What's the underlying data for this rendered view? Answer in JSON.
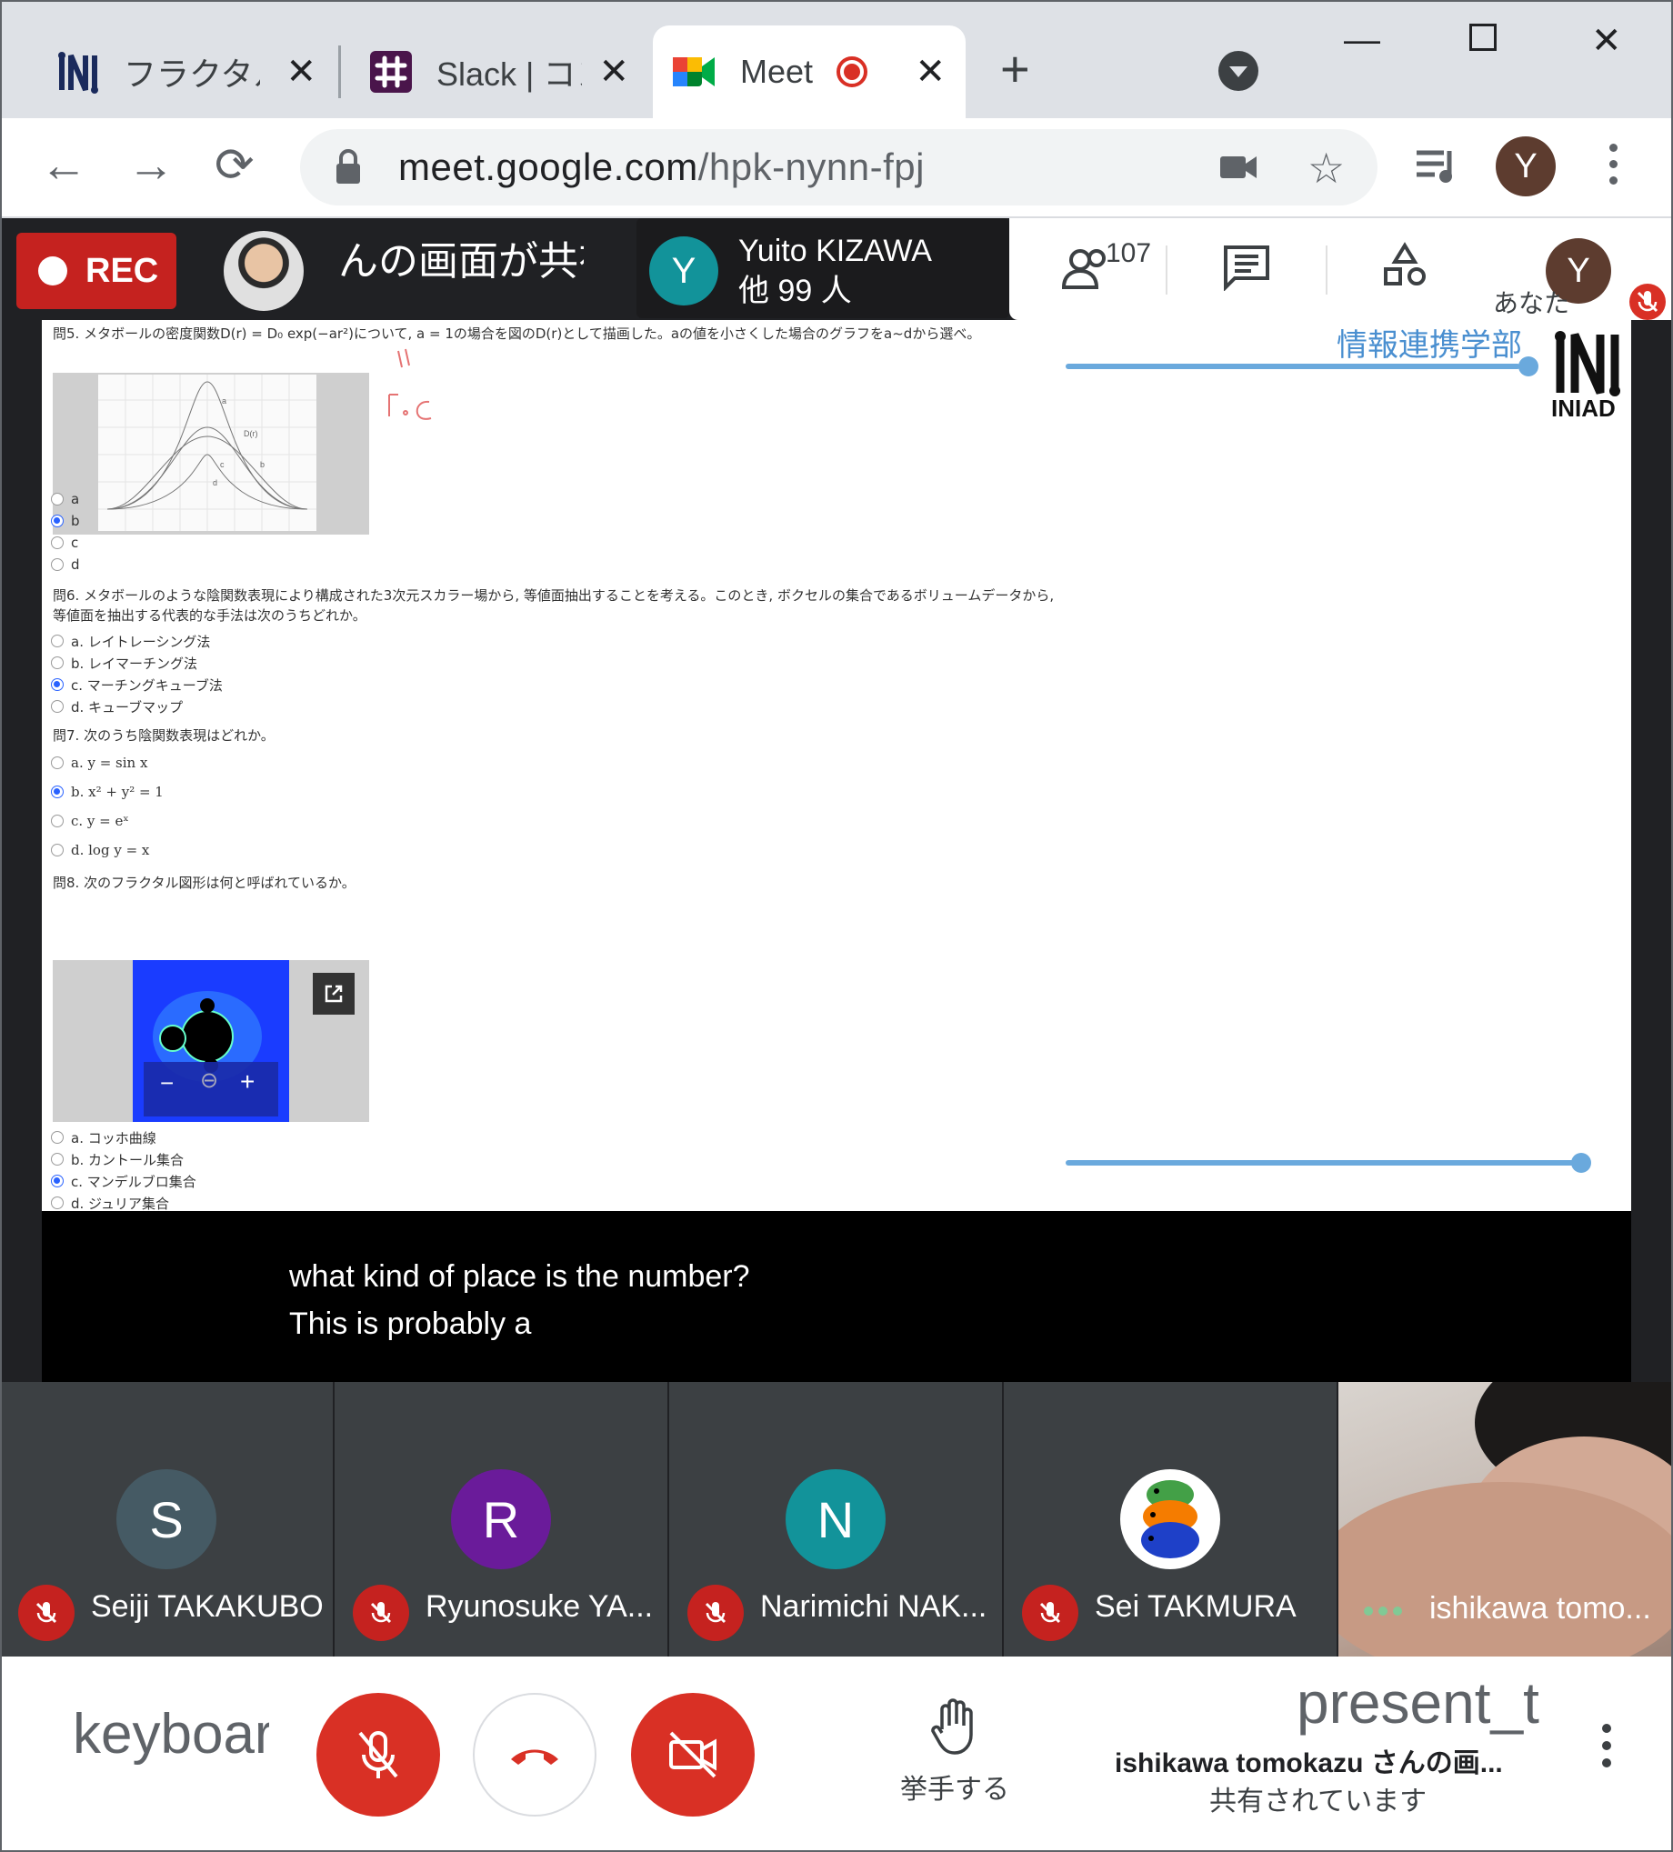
{
  "browser": {
    "tabs": [
      {
        "title": "フラクタルの",
        "icon": "iniad-favicon"
      },
      {
        "title": "Slack | コン",
        "icon": "slack-favicon"
      },
      {
        "title": "Meet",
        "icon": "meet-favicon",
        "recording": true
      }
    ],
    "url_host": "meet.google.com",
    "url_path": "/hpk-nynn-fpj",
    "profile_initial": "Y"
  },
  "meeting": {
    "rec_label": "REC",
    "presenter_text": "んの画面が共有されています",
    "pinned": {
      "initial": "Y",
      "name": "Yuito KIZAWA",
      "others": "他 99 人"
    },
    "participant_count": "107",
    "self_initial": "Y",
    "self_label": "あなた"
  },
  "slide": {
    "brand": "情報連携学部",
    "logo_text": "INIAD",
    "q5_text": "問5. メタボールの密度関数D(r) = D₀ exp(−ar²)について, a = 1の場合を図のD(r)として描画した。aの値を小さくした場合のグラフをa~dから選べ。",
    "q5_options": [
      "a",
      "b",
      "c",
      "d"
    ],
    "q5_selected": 1,
    "graph_labels": {
      "a": "a",
      "b": "b",
      "c": "c",
      "d": "d",
      "curve": "D(r)"
    },
    "q6_text": "問6. メタボールのような陰関数表現により構成された3次元スカラー場から, 等値面抽出することを考える。このとき, ボクセルの集合であるボリュームデータから, 等値面を抽出する代表的な手法は次のうちどれか。",
    "q6_options": [
      "a. レイトレーシング法",
      "b. レイマーチング法",
      "c. マーチングキューブ法",
      "d. キューブマップ"
    ],
    "q6_selected": 2,
    "q7_text": "問7. 次のうち陰関数表現はどれか。",
    "q7_options": [
      "a. y = sin x",
      "b. x² + y² = 1",
      "c. y = eˣ",
      "d. log y = x"
    ],
    "q7_selected": 1,
    "q8_text": "問8. 次のフラクタル図形は何と呼ばれているか。",
    "q8_options": [
      "a. コッホ曲線",
      "b. カントール集合",
      "c. マンデルブロ集合",
      "d. ジュリア集合"
    ],
    "q8_selected": 2,
    "zoom_minus": "−",
    "zoom_plus": "+"
  },
  "captions": {
    "line1": "what kind of place is the number?",
    "line2": "This is probably a"
  },
  "participants": [
    {
      "initial": "S",
      "name": "Seiji TAKAKUBO",
      "color": "#455a64"
    },
    {
      "initial": "R",
      "name": "Ryunosuke YA...",
      "color": "#6a1b9a"
    },
    {
      "initial": "N",
      "name": "Narimichi NAK...",
      "color": "#12939a"
    },
    {
      "initial": "",
      "name": "Sei TAKMURA",
      "color": "#ffffff"
    },
    {
      "initial": "",
      "name": "ishikawa tomo...",
      "color": ""
    }
  ],
  "controls": {
    "keyboard_text": "keyboard",
    "raise_hand": "挙手する",
    "present_big": "present_t",
    "present_line1": "ishikawa tomokazu さんの画...",
    "present_line2": "共有されています"
  },
  "colors": {
    "danger": "#d93025",
    "accent": "#6aa9dd",
    "brand": "#4a8fd0"
  }
}
